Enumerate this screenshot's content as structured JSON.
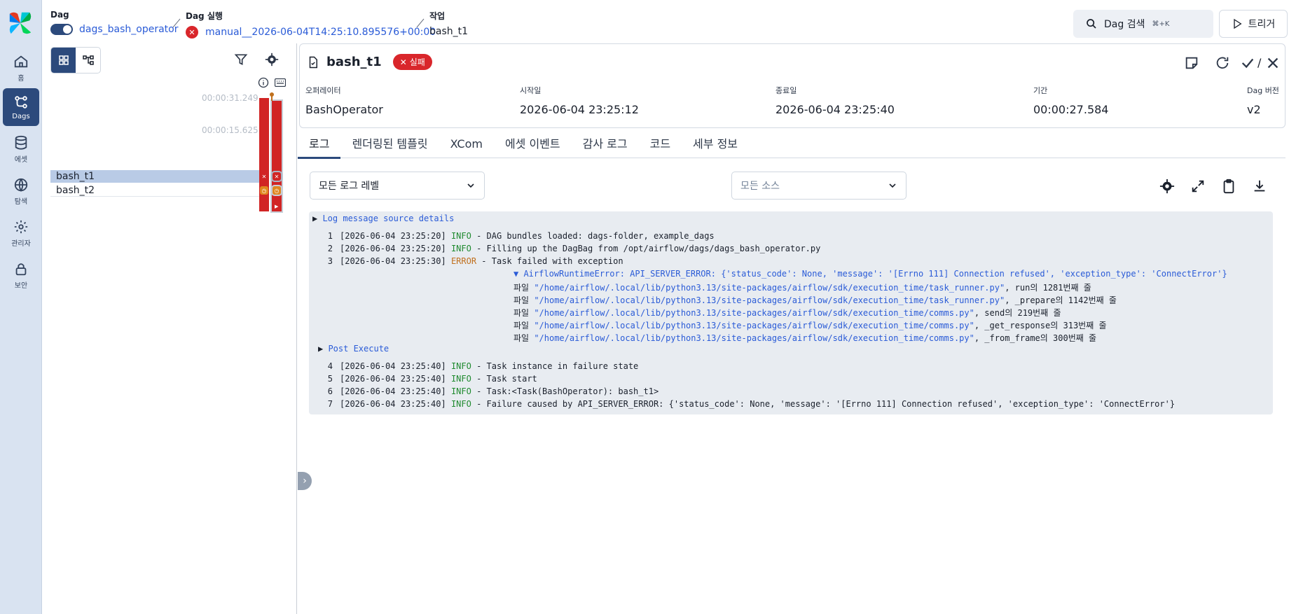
{
  "nav": {
    "items": [
      {
        "label": "홈",
        "icon": "home-icon"
      },
      {
        "label": "Dags",
        "icon": "dags-icon"
      },
      {
        "label": "에셋",
        "icon": "database-icon"
      },
      {
        "label": "탐색",
        "icon": "globe-icon"
      },
      {
        "label": "관리자",
        "icon": "gear-icon"
      },
      {
        "label": "보안",
        "icon": "lock-icon"
      }
    ]
  },
  "header": {
    "dag_label": "Dag",
    "dag_value": "dags_bash_operator",
    "run_label": "Dag 실행",
    "run_value": "manual__2026-06-04T14:25:10.895576+00:00",
    "task_label": "작업",
    "task_value": "bash_t1",
    "search_label": "Dag 검색",
    "search_shortcut": "⌘+K",
    "trigger_label": "트리거"
  },
  "grid": {
    "duration_max": "00:00:31.249",
    "duration_mid": "00:00:15.625",
    "tasks": [
      {
        "name": "bash_t1",
        "state": "failed"
      },
      {
        "name": "bash_t2",
        "state": "upstream_failed"
      }
    ]
  },
  "task_instance": {
    "title": "bash_t1",
    "status": "실패",
    "meta": [
      {
        "label": "오퍼레이터",
        "value": "BashOperator"
      },
      {
        "label": "시작일",
        "value": "2026-06-04 23:25:12"
      },
      {
        "label": "종료일",
        "value": "2026-06-04 23:25:40"
      },
      {
        "label": "기간",
        "value": "00:00:27.584"
      },
      {
        "label": "Dag 버전",
        "value": "v2"
      }
    ],
    "mark_sep": "/"
  },
  "tabs": [
    "로그",
    "렌더링된 템플릿",
    "XCom",
    "에셋 이벤트",
    "감사 로그",
    "코드",
    "세부 정보"
  ],
  "log_controls": {
    "level_select": "모든 로그 레벨",
    "source_select": "모든 소스"
  },
  "log": {
    "source_details": "Log message source details",
    "lines": [
      {
        "n": "1",
        "ts": "[2026-06-04 23:25:20]",
        "level": "INFO",
        "msg": " - DAG bundles loaded: dags-folder, example_dags"
      },
      {
        "n": "2",
        "ts": "[2026-06-04 23:25:20]",
        "level": "INFO",
        "msg": " - Filling up the DagBag from /opt/airflow/dags/dags_bash_operator.py"
      },
      {
        "n": "3",
        "ts": "[2026-06-04 23:25:30]",
        "level": "ERROR",
        "msg": " - Task failed with exception"
      }
    ],
    "exception": "▼ AirflowRuntimeError: API_SERVER_ERROR: {'status_code': None, 'message': '[Errno 111] Connection refused', 'exception_type': 'ConnectError'}",
    "trace": [
      {
        "prefix": "파일 ",
        "path": "\"/home/airflow/.local/lib/python3.13/site-packages/airflow/sdk/execution_time/task_runner.py\"",
        "suffix": ", run의 1281번째 줄"
      },
      {
        "prefix": "파일 ",
        "path": "\"/home/airflow/.local/lib/python3.13/site-packages/airflow/sdk/execution_time/task_runner.py\"",
        "suffix": ", _prepare의 1142번째 줄"
      },
      {
        "prefix": "파일 ",
        "path": "\"/home/airflow/.local/lib/python3.13/site-packages/airflow/sdk/execution_time/comms.py\"",
        "suffix": ", send의 219번째 줄"
      },
      {
        "prefix": "파일 ",
        "path": "\"/home/airflow/.local/lib/python3.13/site-packages/airflow/sdk/execution_time/comms.py\"",
        "suffix": ", _get_response의 313번째 줄"
      },
      {
        "prefix": "파일 ",
        "path": "\"/home/airflow/.local/lib/python3.13/site-packages/airflow/sdk/execution_time/comms.py\"",
        "suffix": ", _from_frame의 300번째 줄"
      }
    ],
    "post_execute": "Post Execute",
    "lines2": [
      {
        "n": "4",
        "ts": "[2026-06-04 23:25:40]",
        "level": "INFO",
        "msg": " - Task instance in failure state"
      },
      {
        "n": "5",
        "ts": "[2026-06-04 23:25:40]",
        "level": "INFO",
        "msg": " - Task start"
      },
      {
        "n": "6",
        "ts": "[2026-06-04 23:25:40]",
        "level": "INFO",
        "msg": " - Task:<Task(BashOperator): bash_t1>"
      },
      {
        "n": "7",
        "ts": "[2026-06-04 23:25:40]",
        "level": "INFO",
        "msg": " - Failure caused by API_SERVER_ERROR: {'status_code': None, 'message': '[Errno 111] Connection refused', 'exception_type': 'ConnectError'}"
      }
    ]
  },
  "colors": {
    "accent": "#2c4a7c",
    "failed": "#d12424",
    "upstream_failed": "#e0871f",
    "info": "#1f8a2f",
    "error": "#c0701e"
  }
}
